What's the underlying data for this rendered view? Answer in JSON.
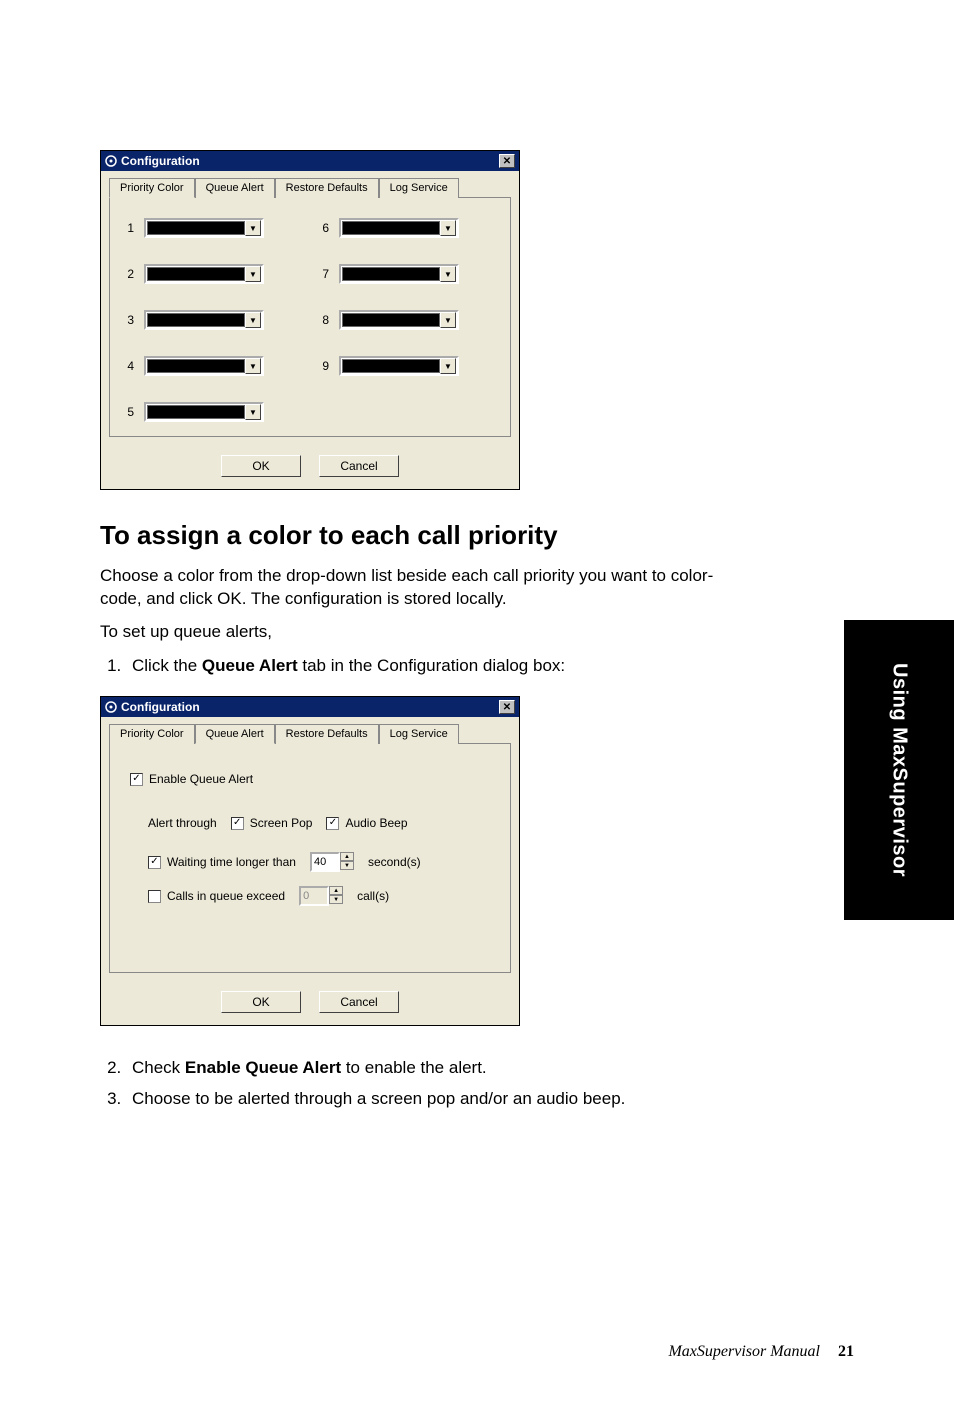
{
  "side_tab": "Using MaxSupervisor",
  "dialog1": {
    "title": "Configuration",
    "tabs": [
      "Priority Color",
      "Queue Alert",
      "Restore Defaults",
      "Log Service"
    ],
    "active_tab": 0,
    "priorities": [
      "1",
      "2",
      "3",
      "4",
      "5",
      "6",
      "7",
      "8",
      "9"
    ],
    "ok": "OK",
    "cancel": "Cancel"
  },
  "section_heading": "To assign a color to each call priority",
  "para1": "Choose a color from the drop-down list beside each call priority you want to color-code, and click OK. The configuration is stored locally.",
  "para2": "To set up queue alerts,",
  "step1_pre": "Click the ",
  "step1_bold": "Queue Alert",
  "step1_post": " tab in the Configuration dialog box:",
  "dialog2": {
    "title": "Configuration",
    "tabs": [
      "Priority Color",
      "Queue Alert",
      "Restore Defaults",
      "Log Service"
    ],
    "active_tab": 1,
    "enable_label": "Enable Queue Alert",
    "enable_checked": true,
    "alert_through": "Alert through",
    "screen_pop": "Screen Pop",
    "screen_pop_checked": true,
    "audio_beep": "Audio Beep",
    "audio_beep_checked": true,
    "waiting_label": "Waiting time longer than",
    "waiting_checked": true,
    "waiting_value": "40",
    "waiting_unit": "second(s)",
    "calls_label": "Calls in queue exceed",
    "calls_checked": false,
    "calls_value": "0",
    "calls_unit": "call(s)",
    "ok": "OK",
    "cancel": "Cancel"
  },
  "step2_pre": "Check ",
  "step2_bold": "Enable Queue Alert",
  "step2_post": " to enable the alert.",
  "step3": "Choose to be alerted through a screen pop and/or an audio beep.",
  "footer_title": "MaxSupervisor Manual",
  "footer_page": "21"
}
